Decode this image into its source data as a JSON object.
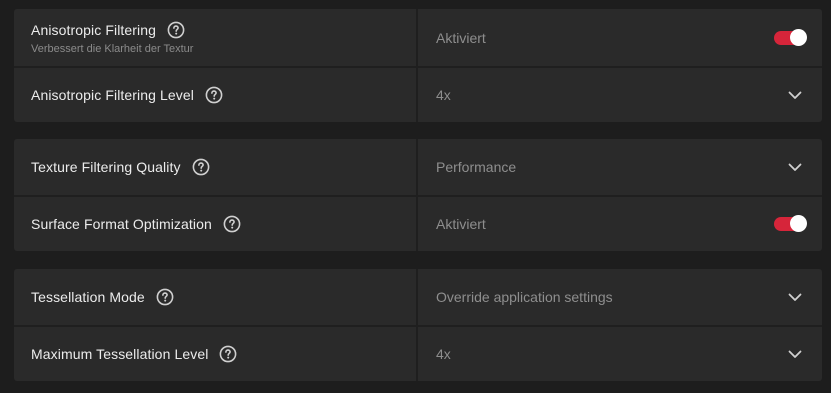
{
  "colors": {
    "background": "#1d1d1d",
    "panel": "#2a2a2a",
    "accent_toggle": "#d6253a",
    "label_text": "#ececec",
    "value_text": "#8e8e8e"
  },
  "groups": [
    {
      "rows": [
        {
          "label": "Anisotropic Filtering",
          "sublabel": "Verbessert die Klarheit der Textur",
          "value": "Aktiviert",
          "control": "toggle",
          "toggle_on": true,
          "icon": "help-circle-icon"
        },
        {
          "label": "Anisotropic Filtering Level",
          "value": "4x",
          "control": "dropdown",
          "icon": "help-circle-icon"
        }
      ]
    },
    {
      "rows": [
        {
          "label": "Texture Filtering Quality",
          "value": "Performance",
          "control": "dropdown",
          "icon": "help-circle-icon"
        },
        {
          "label": "Surface Format Optimization",
          "value": "Aktiviert",
          "control": "toggle",
          "toggle_on": true,
          "icon": "help-circle-icon"
        }
      ]
    },
    {
      "rows": [
        {
          "label": "Tessellation Mode",
          "value": "Override application settings",
          "control": "dropdown",
          "icon": "help-circle-icon"
        },
        {
          "label": "Maximum Tessellation Level",
          "value": "4x",
          "control": "dropdown",
          "icon": "help-circle-icon"
        }
      ]
    }
  ]
}
